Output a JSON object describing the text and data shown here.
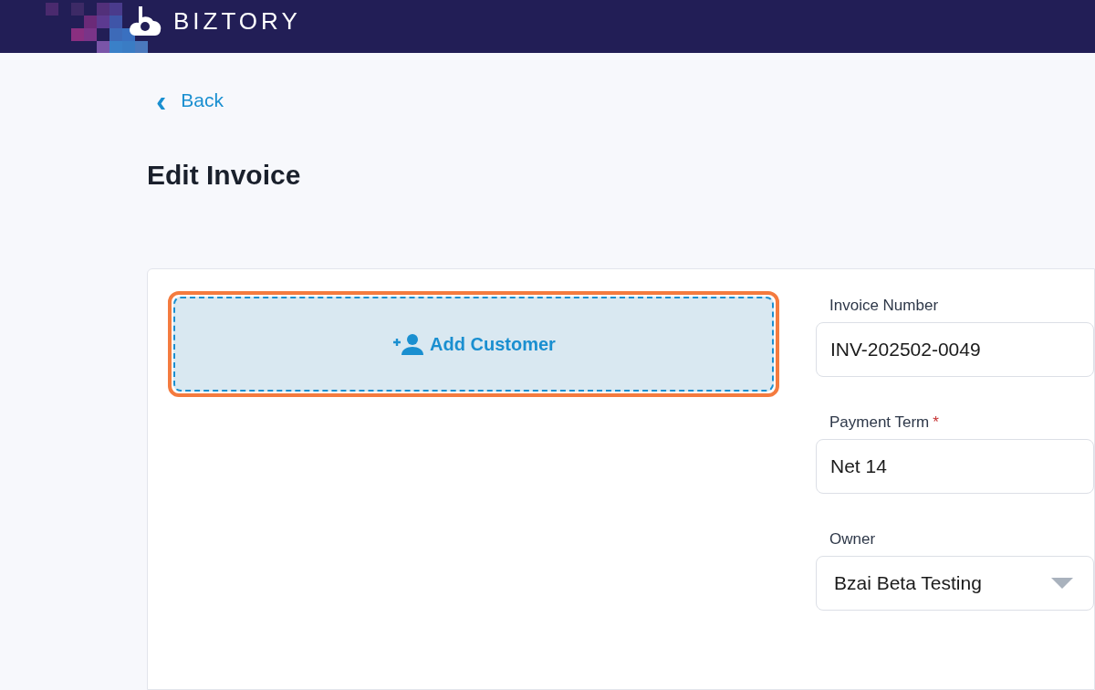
{
  "header": {
    "logo": "BIZTORY"
  },
  "back_link": {
    "icon": "‹",
    "label": "Back"
  },
  "title": "Edit Invoice",
  "add_customer": {
    "label": "Add Customer"
  },
  "fields": [
    {
      "kind": "text",
      "label": "Invoice Number",
      "value": "INV-202502-0049"
    },
    {
      "kind": "text",
      "label": "Payment Term",
      "required_mark": "*",
      "value": "Net 14"
    },
    {
      "kind": "select",
      "label": "Owner",
      "value": "Bzai Beta Testing"
    }
  ]
}
